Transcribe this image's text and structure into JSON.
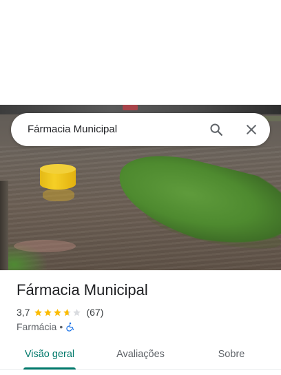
{
  "search": {
    "query": "Fármacia Municipal",
    "search_icon": "search-icon",
    "close_icon": "close-icon"
  },
  "place": {
    "name": "Fármacia Municipal",
    "rating": "3,7",
    "rating_value": 3.7,
    "max_stars": 5,
    "review_count": "(67)",
    "category": "Farmácia",
    "separator": "•",
    "accessibility_icon": "wheelchair-icon"
  },
  "tabs": [
    {
      "label": "Visão geral",
      "active": true
    },
    {
      "label": "Avaliações",
      "active": false
    },
    {
      "label": "Sobre",
      "active": false
    }
  ],
  "colors": {
    "accent": "#00796b",
    "star_filled": "#fbbc04",
    "star_empty": "#dadce0",
    "accessibility": "#1a73e8"
  }
}
